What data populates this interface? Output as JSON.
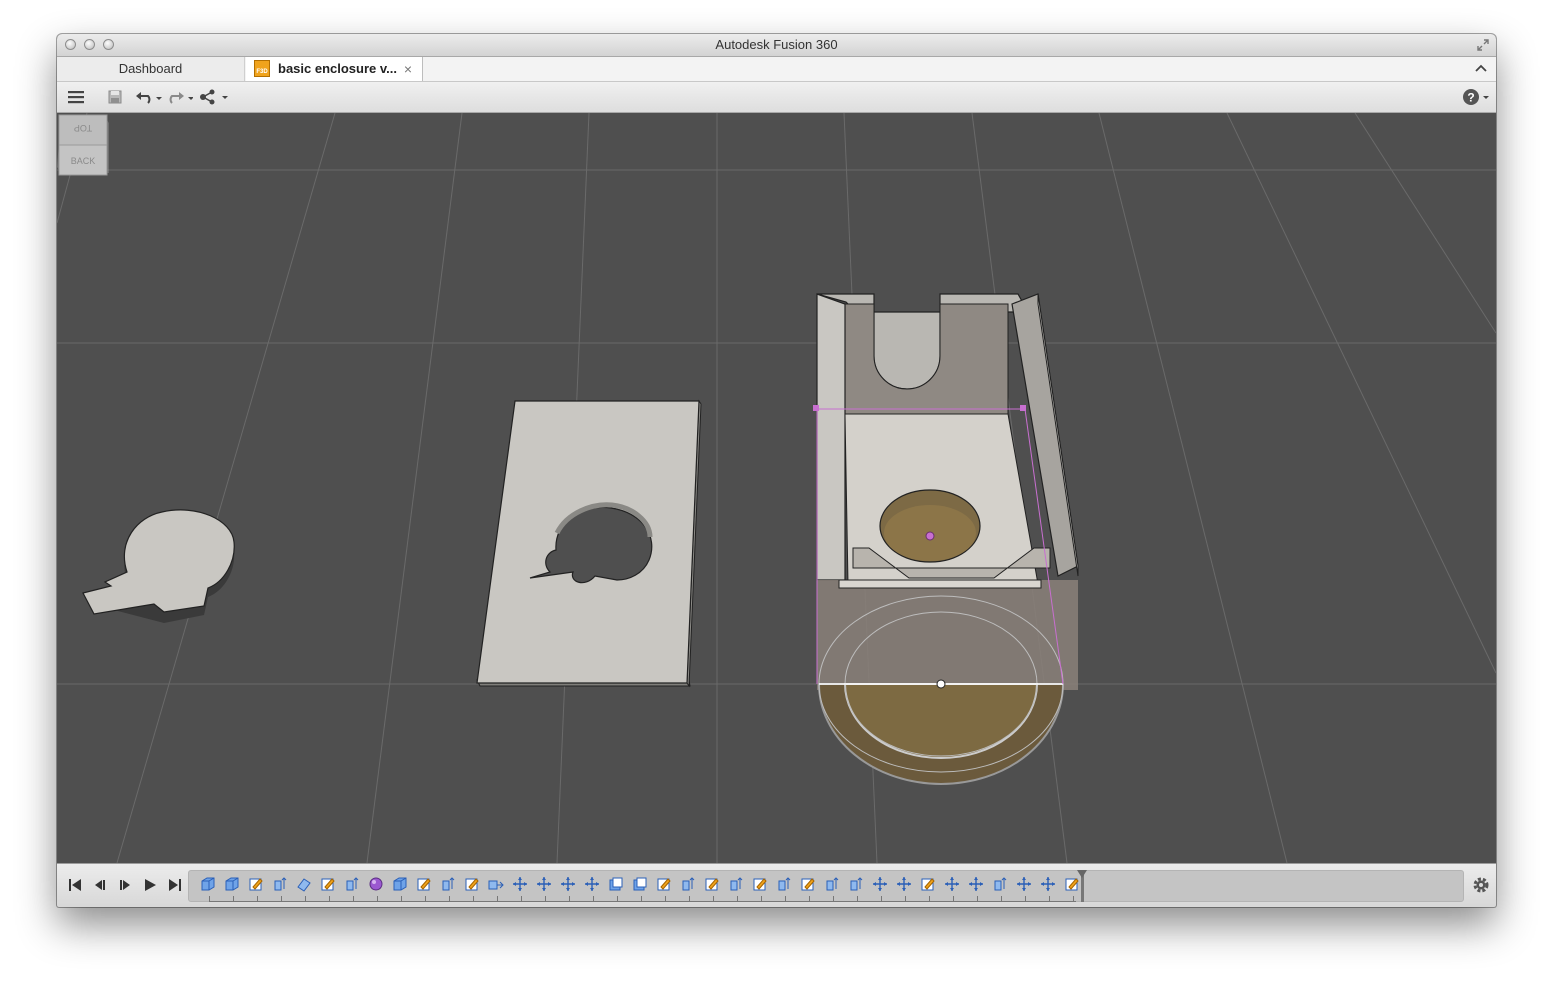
{
  "window": {
    "title": "Autodesk Fusion 360"
  },
  "tabs": [
    {
      "label": "Dashboard"
    },
    {
      "label": "basic enclosure v...",
      "close": "×"
    }
  ],
  "doc_tab_icon_label": "F3D",
  "viewcube": {
    "top_label": "TOP",
    "back_label": "BACK"
  },
  "timeline": {
    "features": [
      "box",
      "box",
      "sketch",
      "extrude",
      "plane",
      "sketch",
      "extrude",
      "sphere",
      "box",
      "sketch",
      "extrude",
      "sketch",
      "joint",
      "move",
      "move",
      "move",
      "move",
      "shell",
      "shell",
      "sketch",
      "extrude",
      "sketch",
      "extrude",
      "sketch",
      "extrude",
      "sketch",
      "extrude",
      "extrude",
      "move",
      "move",
      "sketch",
      "move",
      "move",
      "extrude",
      "move",
      "move",
      "sketch"
    ]
  },
  "colors": {
    "viewport": "#4f4f4f",
    "part": "#c9c7c2",
    "selection": "#c86fd0",
    "accent": "#f0a31c"
  },
  "icons": {
    "menu": "hamburger-icon",
    "save": "save-icon",
    "undo": "undo-icon",
    "redo": "redo-icon",
    "share": "share-icon",
    "help": "help-icon",
    "settings": "gear-icon"
  }
}
